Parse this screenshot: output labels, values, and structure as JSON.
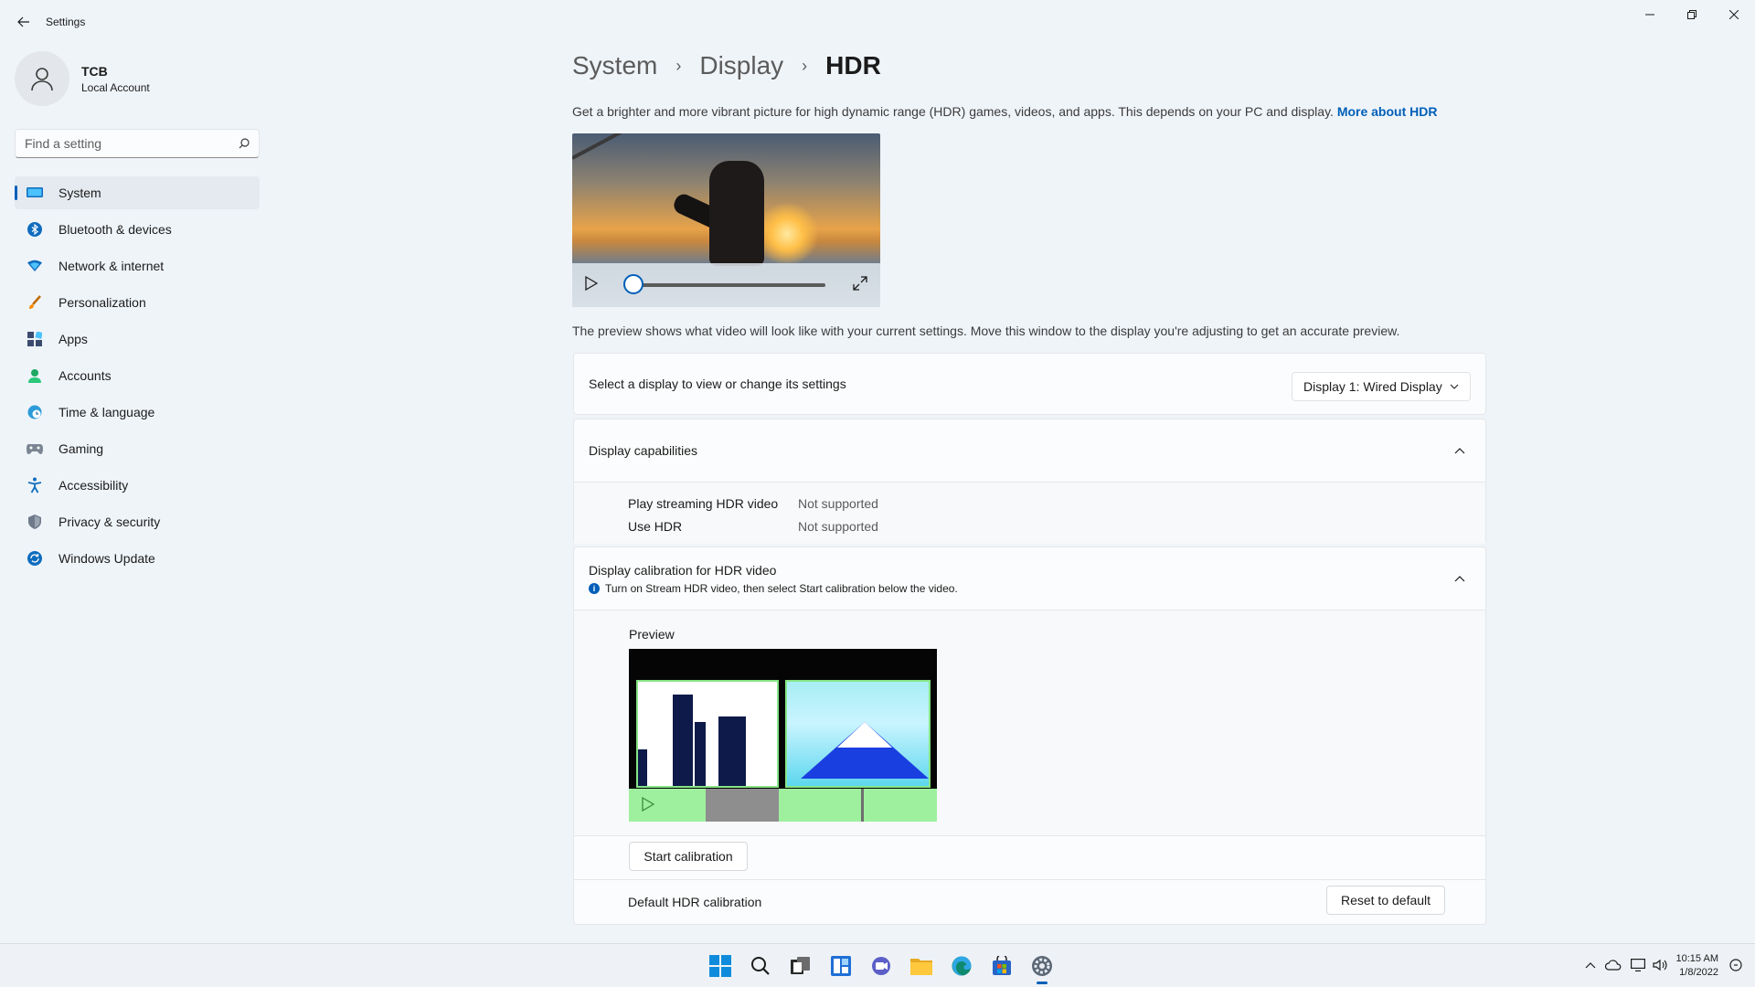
{
  "window": {
    "title": "Settings"
  },
  "profile": {
    "name": "TCB",
    "account_type": "Local Account"
  },
  "search": {
    "placeholder": "Find a setting"
  },
  "sidebar": {
    "items": [
      {
        "label": "System",
        "icon": "system-icon",
        "active": true
      },
      {
        "label": "Bluetooth & devices",
        "icon": "bluetooth-icon"
      },
      {
        "label": "Network & internet",
        "icon": "wifi-icon"
      },
      {
        "label": "Personalization",
        "icon": "brush-icon"
      },
      {
        "label": "Apps",
        "icon": "apps-icon"
      },
      {
        "label": "Accounts",
        "icon": "person-icon"
      },
      {
        "label": "Time & language",
        "icon": "globe-clock-icon"
      },
      {
        "label": "Gaming",
        "icon": "gamepad-icon"
      },
      {
        "label": "Accessibility",
        "icon": "accessibility-icon"
      },
      {
        "label": "Privacy & security",
        "icon": "shield-icon"
      },
      {
        "label": "Windows Update",
        "icon": "update-icon"
      }
    ]
  },
  "breadcrumb": {
    "level1": "System",
    "level2": "Display",
    "current": "HDR"
  },
  "hdr": {
    "description": "Get a brighter and more vibrant picture for high dynamic range (HDR) games, videos, and apps. This depends on your PC and display.",
    "more_link": "More about HDR",
    "video_progress": 0.05,
    "preview_note": "The preview shows what video will look like with your current settings. Move this window to the display you're adjusting to get an accurate preview."
  },
  "display_select": {
    "label": "Select a display to view or change its settings",
    "selected": "Display 1: Wired Display"
  },
  "capabilities": {
    "title": "Display capabilities",
    "rows": [
      {
        "label": "Play streaming HDR video",
        "value": "Not supported"
      },
      {
        "label": "Use HDR",
        "value": "Not supported"
      }
    ]
  },
  "calibration": {
    "title": "Display calibration for HDR video",
    "info": "Turn on Stream HDR video, then select Start calibration below the video.",
    "preview_label": "Preview",
    "start_button": "Start calibration",
    "default_label": "Default HDR calibration",
    "reset_button": "Reset to default"
  },
  "taskbar": {
    "icons": [
      "start-icon",
      "search-icon",
      "task-view-icon",
      "widgets-icon",
      "chat-icon",
      "file-explorer-icon",
      "edge-icon",
      "store-icon",
      "settings-icon"
    ],
    "time": "10:15 AM",
    "date": "1/8/2022"
  },
  "colors": {
    "accent": "#005fb8",
    "background": "#eff4f9"
  }
}
